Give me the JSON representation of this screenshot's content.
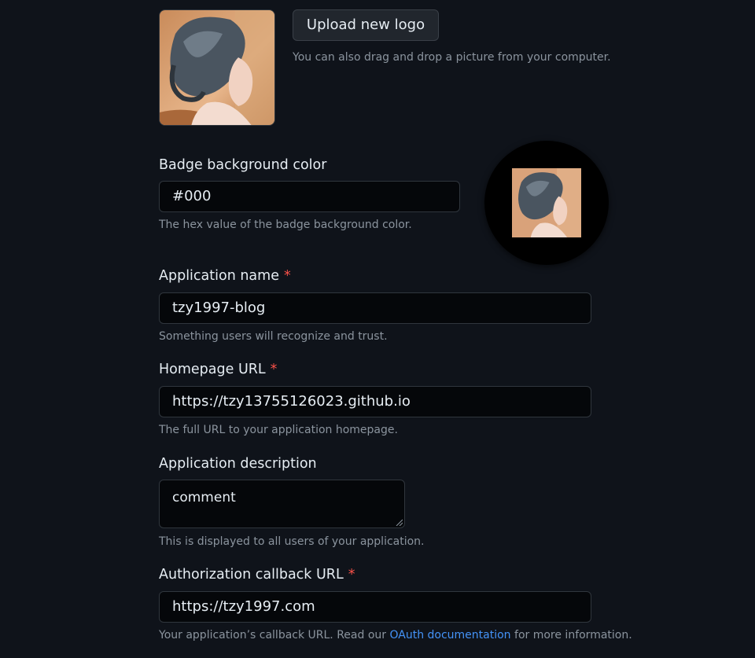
{
  "logo": {
    "upload_button": "Upload new logo",
    "hint": "You can also drag and drop a picture from your computer."
  },
  "badge_color": {
    "label": "Badge background color",
    "value": "#000",
    "hint": "The hex value of the badge background color.",
    "preview_bg": "#000000"
  },
  "app_name": {
    "label": "Application name",
    "required_mark": "*",
    "value": "tzy1997-blog",
    "hint": "Something users will recognize and trust."
  },
  "homepage": {
    "label": "Homepage URL",
    "required_mark": "*",
    "value": "https://tzy13755126023.github.io",
    "hint": "The full URL to your application homepage."
  },
  "description": {
    "label": "Application description",
    "value": "comment",
    "hint": "This is displayed to all users of your application."
  },
  "callback": {
    "label": "Authorization callback URL",
    "required_mark": "*",
    "value": "https://tzy1997.com",
    "hint_before": "Your application’s callback URL. Read our ",
    "hint_link": "OAuth documentation",
    "hint_after": " for more information."
  },
  "colors": {
    "background": "#0f131a",
    "required": "#f85149",
    "link": "#4493f8"
  }
}
